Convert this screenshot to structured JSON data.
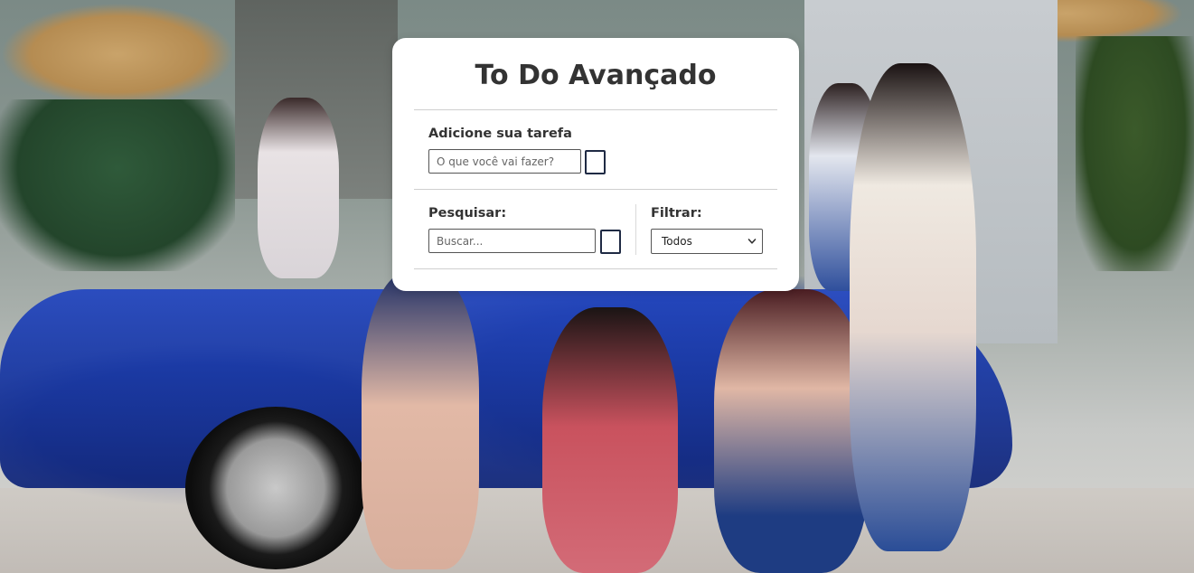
{
  "app": {
    "title": "To Do Avançado"
  },
  "add_task": {
    "label": "Adicione sua tarefa",
    "input_value": "",
    "input_placeholder": "O que você vai fazer?",
    "button_label": ""
  },
  "search": {
    "label": "Pesquisar:",
    "input_value": "",
    "input_placeholder": "Buscar...",
    "button_label": ""
  },
  "filter": {
    "label": "Filtrar:",
    "selected": "Todos"
  },
  "icons": {
    "select_chevron": "chevron-down-icon"
  },
  "colors": {
    "card_background": "#ffffff",
    "text": "#333333",
    "button_border": "#1f2a44"
  }
}
